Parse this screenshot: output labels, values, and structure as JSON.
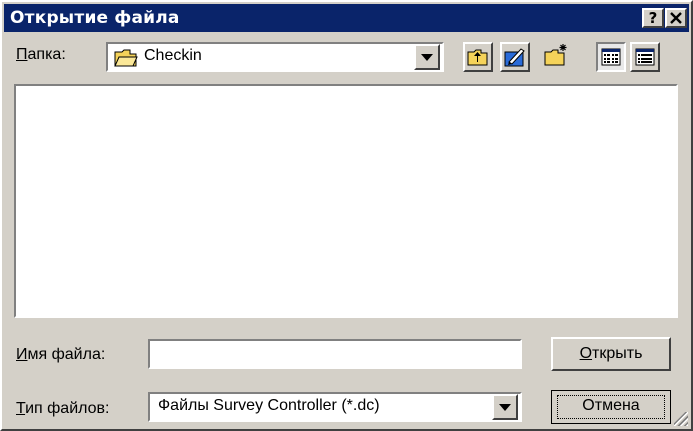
{
  "window": {
    "title": "Открытие файла",
    "help_button": "?",
    "close_button": "×"
  },
  "folder": {
    "label_prefix": "П",
    "label_rest": "апка:",
    "value": "Checkin",
    "icon": "folder-icon"
  },
  "toolbar": {
    "icons": [
      "up-folder-icon",
      "desktop-icon",
      "new-folder-icon",
      "list-view-icon",
      "details-view-icon"
    ]
  },
  "filename": {
    "label_prefix": "И",
    "label_rest": "мя файла:",
    "value": ""
  },
  "filetype": {
    "label_prefix": "Т",
    "label_rest": "ип файлов:",
    "value": "Файлы Survey Controller (*.dc)"
  },
  "buttons": {
    "open_prefix": "О",
    "open_rest": "ткрыть",
    "cancel": "Отмена"
  },
  "colors": {
    "titlebar": "#0a246a",
    "face": "#d4d0c8",
    "folder_yellow": "#f5d35a"
  }
}
